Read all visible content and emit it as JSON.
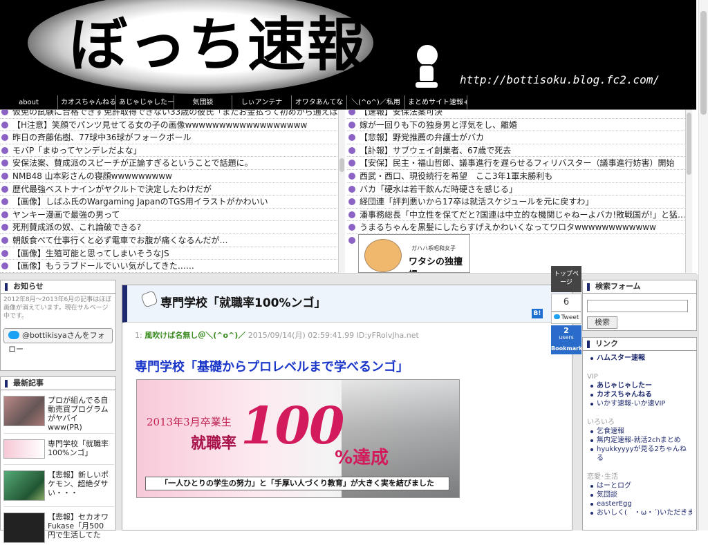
{
  "header": {
    "title": "ぼっち速報",
    "url": "http://bottisoku.blog.fc2.com/"
  },
  "nav": [
    "about",
    "カオスちゃんねる",
    "あじゃじゃしたー",
    "気団談",
    "しぃアンテナ",
    "オワタあんてな",
    "＼(^o^)／私用",
    "まとめサイト速報+"
  ],
  "feeds": {
    "left": [
      "仮免の試験に合格できず免許取得できない33歳の彼氏「またお金払って初めから通えば…",
      "【H注意】笑顔でパンツ見せてる女の子の画像wwwwwwwwwwwwwwwwww",
      "昨日の斉藤佑樹、77球中36球がフォークボール",
      "モバP「まゆってヤンデレだよな」",
      "安保法案、賛成派のスピーチが正論すぎるということで話題に。",
      "NMB48 山本彩さんの寝顔wwwwwwwww",
      "歴代最強ベストナインがヤクルトで決定したわけだが",
      "【画像】しばふ氏のWargaming JapanのTGS用イラストがかわいい",
      "ヤンキー漫画で最強の男って",
      "死刑賛成派の奴、これ論破できる?",
      "朝飯食べて仕事行くと必ず電車でお腹が痛くなるんだが…",
      "【画像】生殖可能と思ってしまいそうなJS",
      "【画像】もうラブドールでいい気がしてきた……"
    ],
    "right": [
      "【速報】安保法案可決",
      "嫁が一回りも下の独身男と浮気をし、離婚",
      "【悲報】野党推薦の弁護士がバカ",
      "【訃報】サブウェイ創業者、67歳で死去",
      "【安保】民主・福山哲郎、議事進行を遅らせるフィリバスター（議事進行妨害）開始",
      "西武・西口、現役続行を希望　ここ3年1軍未勝利も",
      "バカ「硬水は若干飲んだ時硬さを感じる」",
      "経団連「評判悪いから17卒は就活スケジュールを元に戻すわ」",
      "潘事務総長「中立性を保てだと?国連は中立的な機関じゃねーよバカ!敗戦国が!」と猛…",
      "うまるちゃんを黒髪にしたらすげえかわいくなってワロタwwwwwwwwwwww"
    ],
    "ad": {
      "small": "ガハハ系昭和女子",
      "title": "ワタシの独擅場"
    }
  },
  "left_sidebar": {
    "notice": {
      "heading": "お知らせ",
      "text": "2012年8月～2013年6月の記事はほぼ画像が消えています。現在サルベージ中です。",
      "follow": "@bottikisyaさんをフォロー"
    },
    "recent": {
      "heading": "最新記事",
      "items": [
        "プロが組んでる自動売買プログラムがヤバイwww(PR)",
        "専門学校「就職率100%ンゴ」",
        "【悲報】新しいポケモン、超絶ダサい・・・",
        "【悲報】セカオワFukase「月500円で生活してた"
      ]
    }
  },
  "article": {
    "title": "専門学校「就職率100%ンゴ」",
    "bookmark_label": "B!",
    "res_num": "1:",
    "res_name": "風吹けば名無し＠＼(^o^)／",
    "res_date": "2015/09/14(月) 02:59:41.99 ID:yFRolvJha.net",
    "headline": "専門学校「基礎からプロレベルまで学べるンゴ」",
    "banner": {
      "line1": "2013年3月卒業生",
      "line2": "就職率",
      "big": "100",
      "tail": "%達成",
      "caption": "「一人ひとりの学生の努力」と「手厚い人づくり教育」が大きく実を結びました"
    }
  },
  "share": {
    "top_label": "トップページ",
    "count": "6",
    "tweet": "Tweet",
    "users_num": "2",
    "users_label": "users",
    "bookmark": "Bookmark"
  },
  "right_sidebar": {
    "search": {
      "heading": "検索フォーム",
      "button": "検索",
      "placeholder": ""
    },
    "links": {
      "heading": "リンク",
      "top": [
        "ハムスター速報"
      ],
      "groups": [
        {
          "name": "VIP",
          "items": [
            "あじゃじゃしたー",
            "カオスちゃんねる",
            "いかす速報-いか速VIP"
          ]
        },
        {
          "name": "いろいろ",
          "items": [
            "乞食速報",
            "無内定速報-就活2chまとめ",
            "hyukkyyyyが見る2ちゃんねる"
          ]
        },
        {
          "name": "恋愛･生活",
          "items": [
            "はーとログ",
            "気団談",
            "easterEgg",
            "おいしく(｀・ω・´)いただきま"
          ]
        }
      ]
    }
  },
  "colors": {
    "accent": "#1f2a6e",
    "bullet": "#8a63c4",
    "headline": "#1a36c9",
    "name_green": "#3a8a1f",
    "hatena": "#2a6cc9"
  }
}
